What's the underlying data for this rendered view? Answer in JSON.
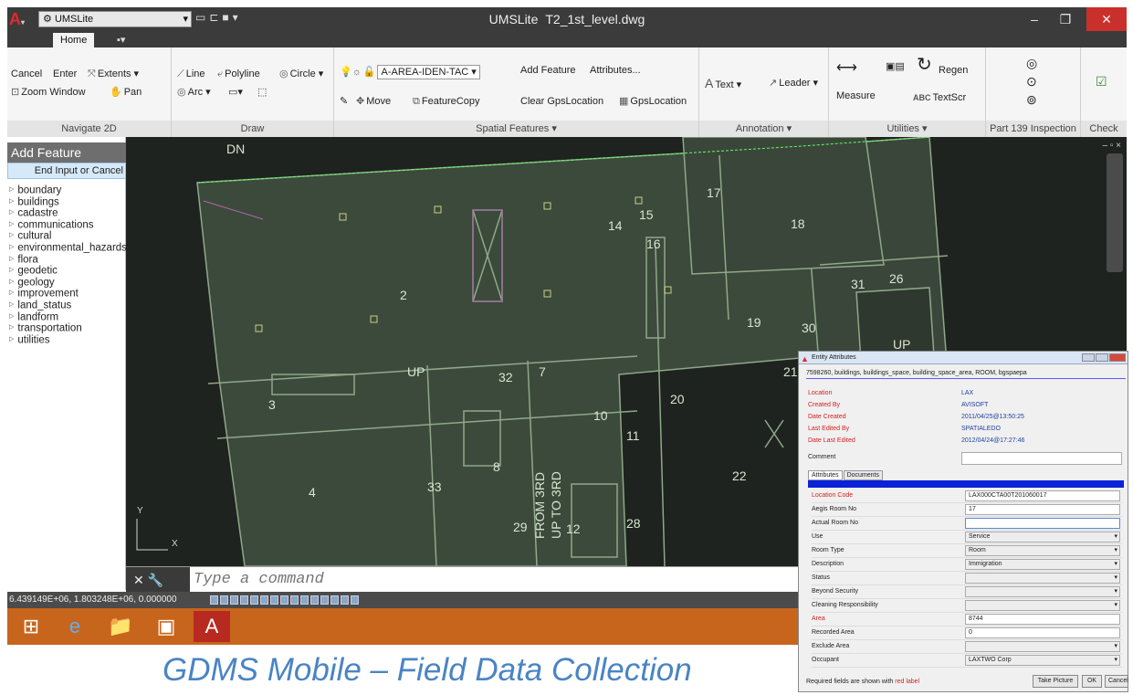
{
  "window": {
    "workspace": "UMSLite",
    "app_name": "UMSLite",
    "file_name": "T2_1st_level.dwg",
    "qa_icons": [
      "new-icon",
      "open-icon",
      "save-icon"
    ]
  },
  "ribbon_tabs": [
    "Home"
  ],
  "ribbon": {
    "navigate": {
      "cancel": "Cancel",
      "enter": "Enter",
      "extents": "Extents",
      "zoom_window": "Zoom Window",
      "pan": "Pan",
      "label": "Navigate 2D"
    },
    "draw": {
      "line": "Line",
      "polyline": "Polyline",
      "circle": "Circle",
      "arc": "Arc",
      "label": "Draw"
    },
    "spatial": {
      "layer": "A-AREA-IDEN-TAC",
      "add_feature": "Add Feature",
      "attributes": "Attributes...",
      "move": "Move",
      "feature_copy": "FeatureCopy",
      "clear_gps": "Clear GpsLocation",
      "gps": "GpsLocation",
      "label": "Spatial Features"
    },
    "annotation": {
      "text": "Text",
      "leader": "Leader",
      "label": "Annotation"
    },
    "utilities": {
      "measure": "Measure",
      "regen": "Regen",
      "textscr": "TextScr",
      "label": "Utilities"
    },
    "part139": {
      "label": "Part 139 Inspection"
    },
    "check": {
      "label": "Check"
    }
  },
  "sidebar": {
    "title": "Add Feature",
    "end_input": "End Input or Cancel",
    "items": [
      "boundary",
      "buildings",
      "cadastre",
      "communications",
      "cultural",
      "environmental_hazards",
      "flora",
      "geodetic",
      "geology",
      "improvement",
      "land_status",
      "landform",
      "transportation",
      "utilities"
    ]
  },
  "drawing": {
    "rooms": [
      "DN",
      "17",
      "14",
      "15",
      "16",
      "18",
      "2",
      "31",
      "26",
      "19",
      "30",
      "UP",
      "21",
      "32",
      "7",
      "20",
      "3",
      "UP",
      "10",
      "8",
      "11",
      "22",
      "4",
      "33",
      "29",
      "12",
      "28",
      "FROM 3RD",
      "UP TO 3RD"
    ],
    "axis_y": "Y",
    "axis_x": "X"
  },
  "command": {
    "placeholder": "Type a command"
  },
  "status": {
    "coords": "6.439149E+06, 1.803248E+06, 0.000000"
  },
  "caption": "GDMS Mobile – Field Data Collection",
  "dialog": {
    "title": "Entity Attributes",
    "path": "7598260, buildings, buildings_space, building_space_area, ROOM, bgspaepa",
    "meta": [
      {
        "label": "Location",
        "value": "LAX"
      },
      {
        "label": "Created By",
        "value": "AVISOFT"
      },
      {
        "label": "Date Created",
        "value": "2011/04/25@13:50:25"
      },
      {
        "label": "Last Edited By",
        "value": "SPATIALEDO"
      },
      {
        "label": "Date Last Edited",
        "value": "2012/04/24@17:27:46"
      }
    ],
    "comment_label": "Comment",
    "tabs": [
      "Attributes",
      "Documents"
    ],
    "fields": [
      {
        "label": "Location Code",
        "value": "LAX000CTA00T201060017",
        "required": true,
        "select": false
      },
      {
        "label": "Aegis Room No",
        "value": "17",
        "required": false,
        "select": false
      },
      {
        "label": "Actual Room No",
        "value": "",
        "required": false,
        "select": false
      },
      {
        "label": "Use",
        "value": "Service",
        "required": false,
        "select": true
      },
      {
        "label": "Room Type",
        "value": "Room",
        "required": false,
        "select": true
      },
      {
        "label": "Description",
        "value": "Immigration",
        "required": false,
        "select": true
      },
      {
        "label": "Status",
        "value": "",
        "required": false,
        "select": true
      },
      {
        "label": "Beyond Security",
        "value": "",
        "required": false,
        "select": true
      },
      {
        "label": "Cleaning Responsibility",
        "value": "",
        "required": false,
        "select": true
      },
      {
        "label": "Area",
        "value": "8744",
        "required": true,
        "select": false
      },
      {
        "label": "Recorded Area",
        "value": "0",
        "required": false,
        "select": false
      },
      {
        "label": "Exclude Area",
        "value": "",
        "required": false,
        "select": true
      },
      {
        "label": "Occupant",
        "value": "LAXTWO Corp",
        "required": false,
        "select": true
      }
    ],
    "footer_note": "Required fields are shown with",
    "footer_red": "red label",
    "buttons": {
      "take_picture": "Take Picture",
      "ok": "OK",
      "cancel": "Cancel"
    }
  },
  "colors": {
    "linework": "#8fa88a",
    "room_fill": "#3c4a3c",
    "canvas": "#1f231f",
    "taskbar": "#c8651c",
    "caption": "#4a84c4",
    "required": "#d32020"
  }
}
